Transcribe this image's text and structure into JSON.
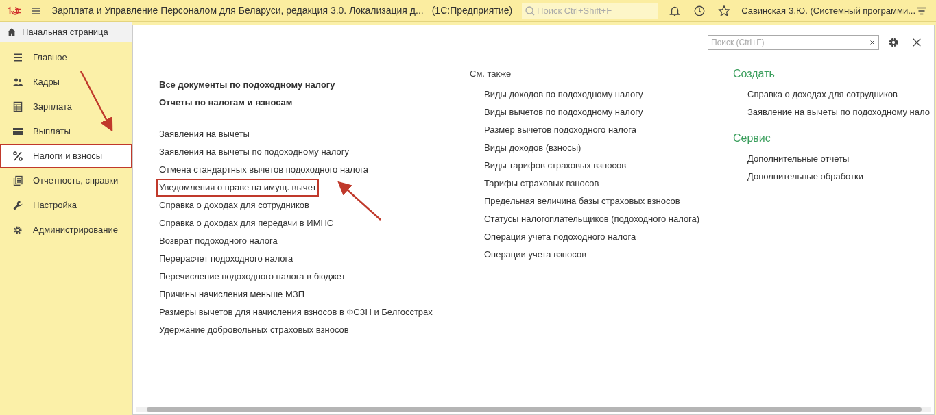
{
  "app_bar": {
    "title": "Зарплата и Управление Персоналом для Беларуси, редакция 3.0. Локализация д...",
    "platform": "(1С:Предприятие)",
    "search": {
      "placeholder": "Поиск Ctrl+Shift+F"
    },
    "user": "Савинская З.Ю. (Системный программи..."
  },
  "home_tab": {
    "label": "Начальная страница"
  },
  "sidebar": {
    "items": [
      {
        "label": "Главное",
        "selected": false,
        "highlighted": false
      },
      {
        "label": "Кадры",
        "selected": false,
        "highlighted": false
      },
      {
        "label": "Зарплата",
        "selected": false,
        "highlighted": false
      },
      {
        "label": "Выплаты",
        "selected": false,
        "highlighted": false
      },
      {
        "label": "Налоги и взносы",
        "selected": true,
        "highlighted": true
      },
      {
        "label": "Отчетность, справки",
        "selected": false,
        "highlighted": false
      },
      {
        "label": "Настройка",
        "selected": false,
        "highlighted": false
      },
      {
        "label": "Администрирование",
        "selected": false,
        "highlighted": false
      }
    ]
  },
  "panel": {
    "search": {
      "placeholder": "Поиск (Ctrl+F)"
    },
    "main_links": {
      "bold": [
        {
          "label": "Все документы по подоходному налогу"
        },
        {
          "label": "Отчеты по налогам и взносам"
        }
      ],
      "items": [
        {
          "label": "Заявления на вычеты",
          "highlighted": false
        },
        {
          "label": "Заявления на вычеты по подоходному налогу",
          "highlighted": false
        },
        {
          "label": "Отмена стандартных вычетов подоходного налога",
          "highlighted": false
        },
        {
          "label": "Уведомления о праве на имущ. вычет",
          "highlighted": true
        },
        {
          "label": "Справка о доходах для сотрудников",
          "highlighted": false
        },
        {
          "label": "Справка о доходах для передачи в ИМНС",
          "highlighted": false
        },
        {
          "label": "Возврат подоходного налога",
          "highlighted": false
        },
        {
          "label": "Перерасчет подоходного налога",
          "highlighted": false
        },
        {
          "label": "Перечисление подоходного налога в бюджет",
          "highlighted": false
        },
        {
          "label": "Причины начисления меньше МЗП",
          "highlighted": false
        },
        {
          "label": "Размеры вычетов для начисления взносов в ФСЗН и Белгосстрах",
          "highlighted": false
        },
        {
          "label": "Удержание добровольных страховых взносов",
          "highlighted": false
        }
      ]
    },
    "see_also": {
      "heading": "См. также",
      "items": [
        "Виды доходов по подоходному налогу",
        "Виды вычетов по подоходному налогу",
        "Размер вычетов подоходного налога",
        "Виды доходов (взносы)",
        "Виды тарифов страховых взносов",
        "Тарифы страховых взносов",
        "Предельная величина базы страховых взносов",
        "Статусы налогоплательщиков (подоходного налога)",
        "Операция учета подоходного налога",
        "Операции учета взносов"
      ]
    },
    "sections": [
      {
        "heading": "Создать",
        "items": [
          "Справка о доходах для сотрудников",
          "Заявление на вычеты по подоходному нало"
        ]
      },
      {
        "heading": "Сервис",
        "items": [
          "Дополнительные отчеты",
          "Дополнительные обработки"
        ]
      }
    ]
  }
}
